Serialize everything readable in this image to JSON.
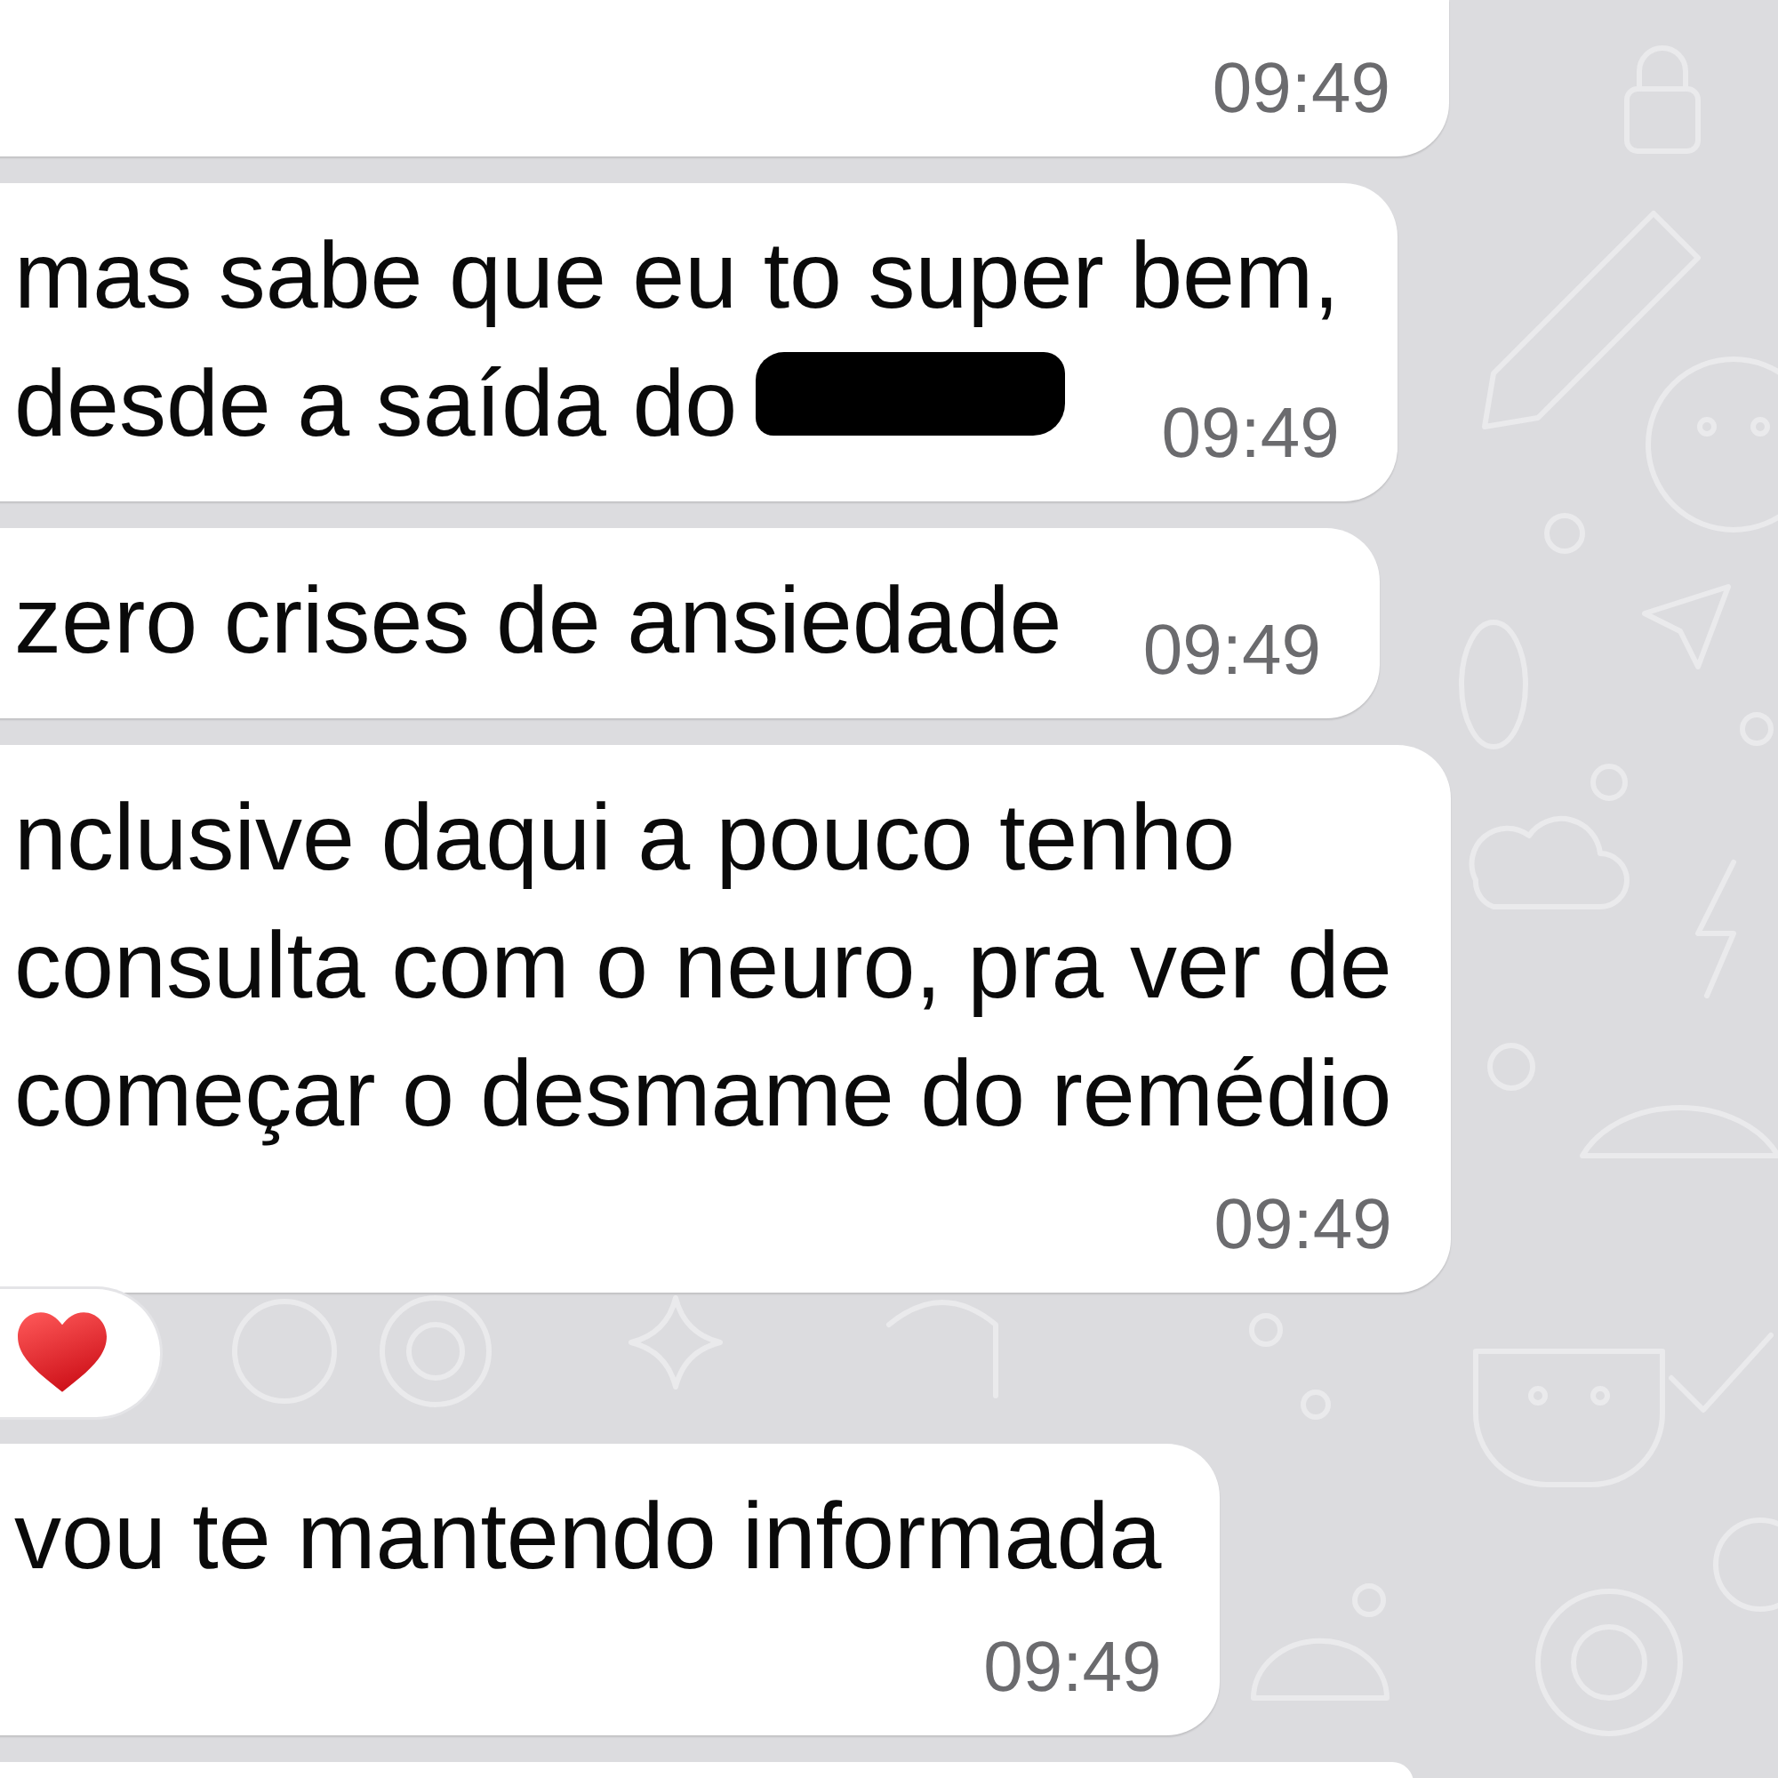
{
  "messages": [
    {
      "kind": "cut-top",
      "time": "09:49"
    },
    {
      "kind": "full",
      "lines": [
        "mas sabe que eu to super bem,",
        "desde a saída do"
      ],
      "redacted": true,
      "time": "09:49"
    },
    {
      "kind": "full",
      "lines": [
        "zero crises de ansiedade"
      ],
      "time": "09:49"
    },
    {
      "kind": "full",
      "lines": [
        "nclusive daqui a pouco tenho",
        "consulta com o neuro, pra ver de",
        "começar o desmame do remédio"
      ],
      "time": "09:49",
      "reaction": {
        "kind": "heart"
      }
    },
    {
      "kind": "full",
      "lines": [
        "vou te mantendo informada"
      ],
      "time": "09:49"
    },
    {
      "kind": "cut-bottom"
    }
  ]
}
